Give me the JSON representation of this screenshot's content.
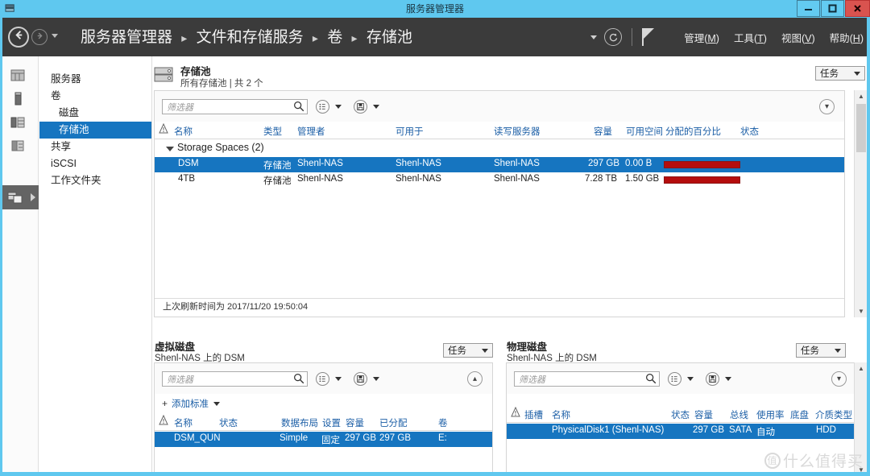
{
  "window": {
    "title": "服务器管理器",
    "icon": "server-manager-icon",
    "controls": {
      "minimize": "—",
      "maximize": "❐",
      "close": "✕"
    }
  },
  "header": {
    "back_icon": "arrow-left-icon",
    "forward_icon": "arrow-right-icon",
    "breadcrumb": [
      "服务器管理器",
      "文件和存储服务",
      "卷",
      "存储池"
    ],
    "separator": "▸",
    "refresh_icon": "refresh-icon",
    "flag_icon": "notifications-flag-icon",
    "menus": [
      {
        "label": "管理",
        "accel": "M"
      },
      {
        "label": "工具",
        "accel": "T"
      },
      {
        "label": "视图",
        "accel": "V"
      },
      {
        "label": "帮助",
        "accel": "H"
      }
    ]
  },
  "sidebar": {
    "strip_icons": [
      "dashboard-icon",
      "local-server-icon",
      "all-servers-icon",
      "file-services-icon",
      "storage-services-icon"
    ],
    "items": [
      {
        "label": "服务器",
        "selected": false,
        "indent": false
      },
      {
        "label": "卷",
        "selected": false,
        "indent": false
      },
      {
        "label": "磁盘",
        "selected": false,
        "indent": true
      },
      {
        "label": "存储池",
        "selected": true,
        "indent": true
      },
      {
        "label": "共享",
        "selected": false,
        "indent": false
      },
      {
        "label": "iSCSI",
        "selected": false,
        "indent": false
      },
      {
        "label": "工作文件夹",
        "selected": false,
        "indent": false
      }
    ]
  },
  "storage_pools": {
    "icon": "storage-pool-icon",
    "title": "存储池",
    "subtitle": "所有存储池 | 共 2 个",
    "tasks_label": "任务",
    "filter_placeholder": "筛选器",
    "search_icon": "search-icon",
    "view_icon": "list-view-icon",
    "save_icon": "save-view-icon",
    "collapse_icon": "chevron-down-icon",
    "warning_icon": "warning-icon",
    "columns": [
      "名称",
      "类型",
      "管理者",
      "可用于",
      "读写服务器",
      "容量",
      "可用空间",
      "分配的百分比",
      "状态"
    ],
    "group_label": "Storage Spaces (2)",
    "rows": [
      {
        "name": "DSM",
        "type": "存储池",
        "managed_by": "Shenl-NAS",
        "available_to": "Shenl-NAS",
        "rw_server": "Shenl-NAS",
        "capacity": "297 GB",
        "free_space": "0.00 B",
        "allocated_pct": 100,
        "status": "",
        "selected": true
      },
      {
        "name": "4TB",
        "type": "存储池",
        "managed_by": "Shenl-NAS",
        "available_to": "Shenl-NAS",
        "rw_server": "Shenl-NAS",
        "capacity": "7.28 TB",
        "free_space": "1.50 GB",
        "allocated_pct": 100,
        "status": "",
        "selected": false
      }
    ],
    "refresh_note": "上次刷新时间为 2017/11/20 19:50:04"
  },
  "virtual_disks": {
    "title": "虚拟磁盘",
    "subtitle_prefix": "Shenl-NAS ",
    "subtitle_link": "上的",
    "subtitle_suffix": " DSM",
    "subtitle": "Shenl-NAS 上的 DSM",
    "tasks_label": "任务",
    "filter_placeholder": "筛选器",
    "add_criteria_label": "添加标准",
    "expand_icon": "chevron-up-icon",
    "columns": [
      "名称",
      "状态",
      "数据布局",
      "设置",
      "容量",
      "已分配",
      "卷"
    ],
    "rows": [
      {
        "name": "DSM_QUN",
        "status": "",
        "layout": "Simple",
        "provisioning": "固定",
        "capacity": "297 GB",
        "allocated": "297 GB",
        "volume": "E:",
        "selected": true
      }
    ]
  },
  "physical_disks": {
    "title": "物理磁盘",
    "subtitle": "Shenl-NAS 上的 DSM",
    "tasks_label": "任务",
    "filter_placeholder": "筛选器",
    "collapse_icon": "chevron-down-icon",
    "columns": [
      "插槽",
      "名称",
      "状态",
      "容量",
      "总线",
      "使用率",
      "底盘",
      "介质类型"
    ],
    "rows": [
      {
        "slot": "",
        "name": "PhysicalDisk1 (Shenl-NAS)",
        "status": "",
        "capacity": "297 GB",
        "bus": "SATA",
        "usage": "自动",
        "chassis": "",
        "media_type": "HDD",
        "selected": true
      }
    ]
  },
  "watermark": {
    "mark": "值",
    "text": "什么值得买"
  },
  "colors": {
    "titlebar": "#5fc8ef",
    "header": "#3b3b3b",
    "selection": "#1675c0",
    "column_header_text": "#1b5ea6",
    "alloc_bar": "#b50d0d",
    "close_button": "#d9534f"
  }
}
